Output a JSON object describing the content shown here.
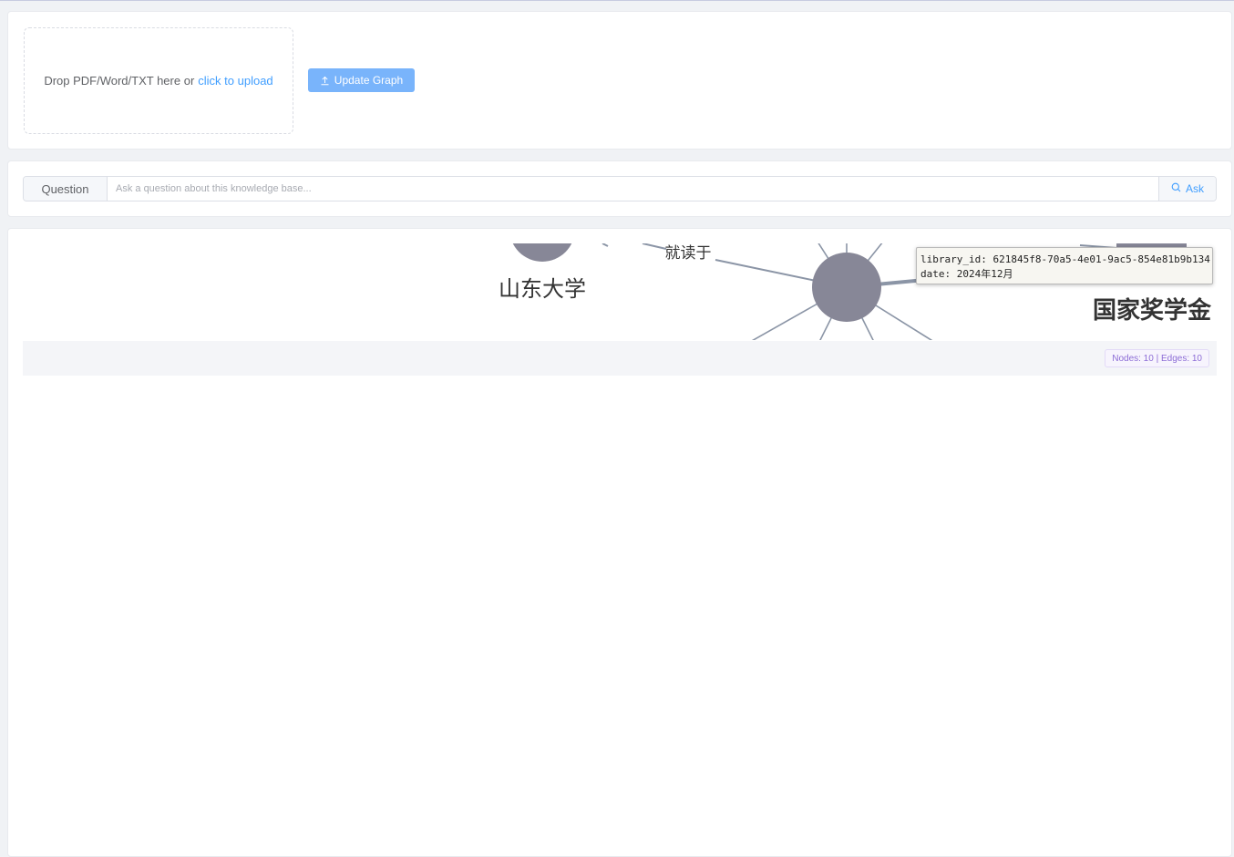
{
  "upload": {
    "drop_text": "Drop PDF/Word/TXT here or",
    "upload_link": "click to upload",
    "update_button": "Update Graph",
    "update_icon": "upload-icon"
  },
  "question": {
    "label": "Question",
    "placeholder": "Ask a question about this knowledge base...",
    "value": "",
    "ask_button": "Ask",
    "ask_icon": "search-icon"
  },
  "graph": {
    "nodes": [
      {
        "label": "山东大学"
      },
      {
        "label": "国家奖学金"
      }
    ],
    "edges": [
      {
        "label": "就读于"
      }
    ],
    "tooltip": {
      "line1": "library_id: 621845f8-70a5-4e01-9ac5-854e81b9b134",
      "line2": "date: 2024年12月"
    },
    "stats": "Nodes: 10 | Edges: 10"
  },
  "colors": {
    "primary": "#409eff",
    "primary_light": "#79b4fb",
    "node": "#878797",
    "edge": "#8b95a6",
    "badge": "#8c6cd6"
  }
}
